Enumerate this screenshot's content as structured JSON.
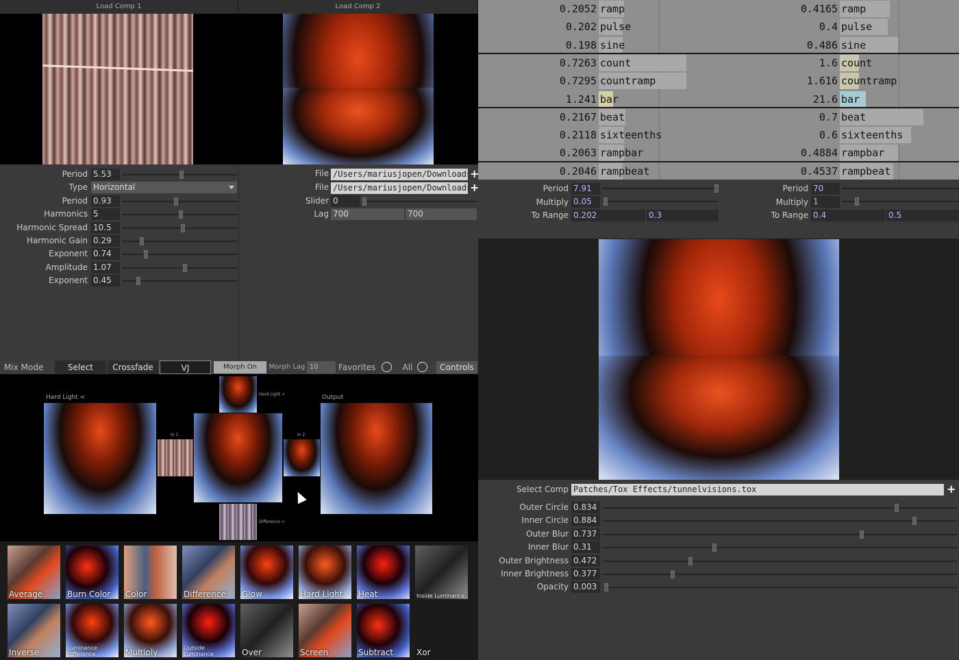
{
  "comps": {
    "comp1_title": "Load Comp 1",
    "comp2_title": "Load Comp 2"
  },
  "comp1_params": [
    {
      "label": "Period",
      "value": "5.53",
      "frac": 0.52
    },
    {
      "label": "Type",
      "value": "Horizontal",
      "kind": "dropdown"
    },
    {
      "label": "Period",
      "value": "0.93",
      "frac": 0.47
    },
    {
      "label": "Harmonics",
      "value": "5",
      "frac": 0.51
    },
    {
      "label": "Harmonic Spread",
      "value": "10.5",
      "frac": 0.53
    },
    {
      "label": "Harmonic Gain",
      "value": "0.29",
      "frac": 0.16
    },
    {
      "label": "Exponent",
      "value": "0.74",
      "frac": 0.2
    },
    {
      "label": "Amplitude",
      "value": "1.07",
      "frac": 0.55
    },
    {
      "label": "Exponent",
      "value": "0.45",
      "frac": 0.13
    }
  ],
  "comp2_params": {
    "file1_label": "File",
    "file1_value": "/Users/mariusjopen/Downloads/",
    "file2_label": "File",
    "file2_value": "/Users/mariusjopen/Downloads/",
    "slider_label": "Slider",
    "slider_value": "0",
    "lag_label": "Lag",
    "lag_value1": "700",
    "lag_value2": "700"
  },
  "mix_bar": {
    "mix_mode": "Mix Mode",
    "select": "Select",
    "crossfade": "Crossfade",
    "vj": "VJ",
    "morph_on": "Morph On",
    "morph_lag_label": "Morph Lag",
    "morph_lag_value": "10",
    "favorites": "Favorites",
    "all": "All",
    "controls": "Controls"
  },
  "mix_view": {
    "left_caption": "Hard Light  <",
    "in1": "In 1",
    "in2": "In 2",
    "top_caption": "Hard Light  <",
    "bottom_caption": "Difference  <",
    "output": "Output"
  },
  "blend_modes_row1": [
    "Average",
    "Burn Color",
    "Color",
    "Difference",
    "Glow",
    "Hard Light",
    "Heat",
    "Inside Luminance"
  ],
  "blend_modes_row2": [
    "Inverse",
    "Luminance Difference",
    "Multiply",
    "Outside Luminance",
    "Over",
    "Screen",
    "Subtract",
    "Xor"
  ],
  "lfo_left": [
    {
      "num": "0.2052",
      "name": "ramp",
      "frac": 0.21
    },
    {
      "num": "0.202",
      "name": "pulse",
      "frac": 0.2
    },
    {
      "num": "0.198",
      "name": "sine",
      "frac": 0.2
    },
    {
      "num": "0.7263",
      "name": "count",
      "frac": 0.73
    },
    {
      "num": "0.7295",
      "name": "countramp",
      "frac": 0.73
    },
    {
      "num": "1.241",
      "name": "bar",
      "frac": 0.12,
      "color": "#d4cfa6"
    },
    {
      "num": "0.2167",
      "name": "beat",
      "frac": 0.22
    },
    {
      "num": "0.2118",
      "name": "sixteenths",
      "frac": 0.21
    },
    {
      "num": "0.2063",
      "name": "rampbar",
      "frac": 0.21
    },
    {
      "num": "0.2046",
      "name": "rampbeat",
      "frac": 0.2
    }
  ],
  "lfo_right": [
    {
      "num": "0.4165",
      "name": "ramp",
      "frac": 0.42
    },
    {
      "num": "0.4",
      "name": "pulse",
      "frac": 0.4
    },
    {
      "num": "0.486",
      "name": "sine",
      "frac": 0.49
    },
    {
      "num": "1.6",
      "name": "count",
      "frac": 0.16,
      "color": "#c9c6ad"
    },
    {
      "num": "1.616",
      "name": "countramp",
      "frac": 0.16,
      "color": "#c9c6ad"
    },
    {
      "num": "21.6",
      "name": "bar",
      "frac": 0.22,
      "color": "#a6cbd2"
    },
    {
      "num": "0.7",
      "name": "beat",
      "frac": 0.7
    },
    {
      "num": "0.6",
      "name": "sixteenths",
      "frac": 0.6
    },
    {
      "num": "0.4884",
      "name": "rampbar",
      "frac": 0.49
    },
    {
      "num": "0.4537",
      "name": "rampbeat",
      "frac": 0.45
    }
  ],
  "lfo_left_params": {
    "period_label": "Period",
    "period_value": "7.91",
    "multiply_label": "Multiply",
    "multiply_value": "0.05",
    "range_label": "To Range",
    "range_v1": "0.202",
    "range_v2": "0.3"
  },
  "lfo_right_params": {
    "period_label": "Period",
    "period_value": "70",
    "multiply_label": "Multiply",
    "multiply_value": "1",
    "range_label": "To Range",
    "range_v1": "0.4",
    "range_v2": "0.5"
  },
  "effect": {
    "select_label": "Select Comp",
    "select_value": "Patches/Tox Effects/tunnelvisions.tox",
    "params": [
      {
        "label": "Outer Circle",
        "value": "0.834",
        "frac": 0.83
      },
      {
        "label": "Inner Circle",
        "value": "0.884",
        "frac": 0.88
      },
      {
        "label": "Outer Blur",
        "value": "0.737",
        "frac": 0.73
      },
      {
        "label": "Inner Blur",
        "value": "0.31",
        "frac": 0.31
      },
      {
        "label": "Outer Brightness",
        "value": "0.472",
        "frac": 0.24
      },
      {
        "label": "Inner Brightness",
        "value": "0.377",
        "frac": 0.19
      },
      {
        "label": "Opacity",
        "value": "0.003",
        "frac": 0.0
      }
    ]
  },
  "colors": {
    "panel": "#3a3a3a",
    "field": "#2b2b2b",
    "lfo_bg": "#8f8f8f",
    "bar_fill": "#a9a9a9"
  }
}
